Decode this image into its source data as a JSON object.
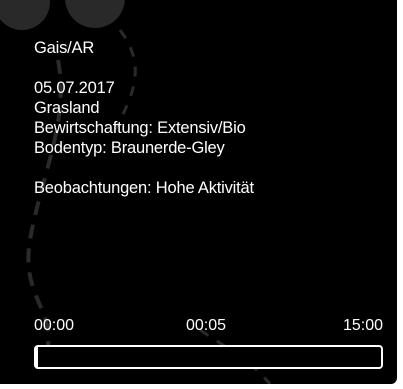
{
  "info": {
    "location": "Gais/AR",
    "date": "05.07.2017",
    "habitat": "Grasland",
    "management": "Bewirtschaftung: Extensiv/Bio",
    "soil": "Bodentyp: Braunerde-Gley",
    "observation": "Beobachtungen: Hohe Aktivität"
  },
  "timeline": {
    "start_label": "00:00",
    "current_label": "00:05",
    "end_label": "15:00",
    "progress_fraction": 0.0056
  },
  "colors": {
    "panel_background": "#000000",
    "text": "#ffffff",
    "decoration": "#2a2a2a"
  }
}
